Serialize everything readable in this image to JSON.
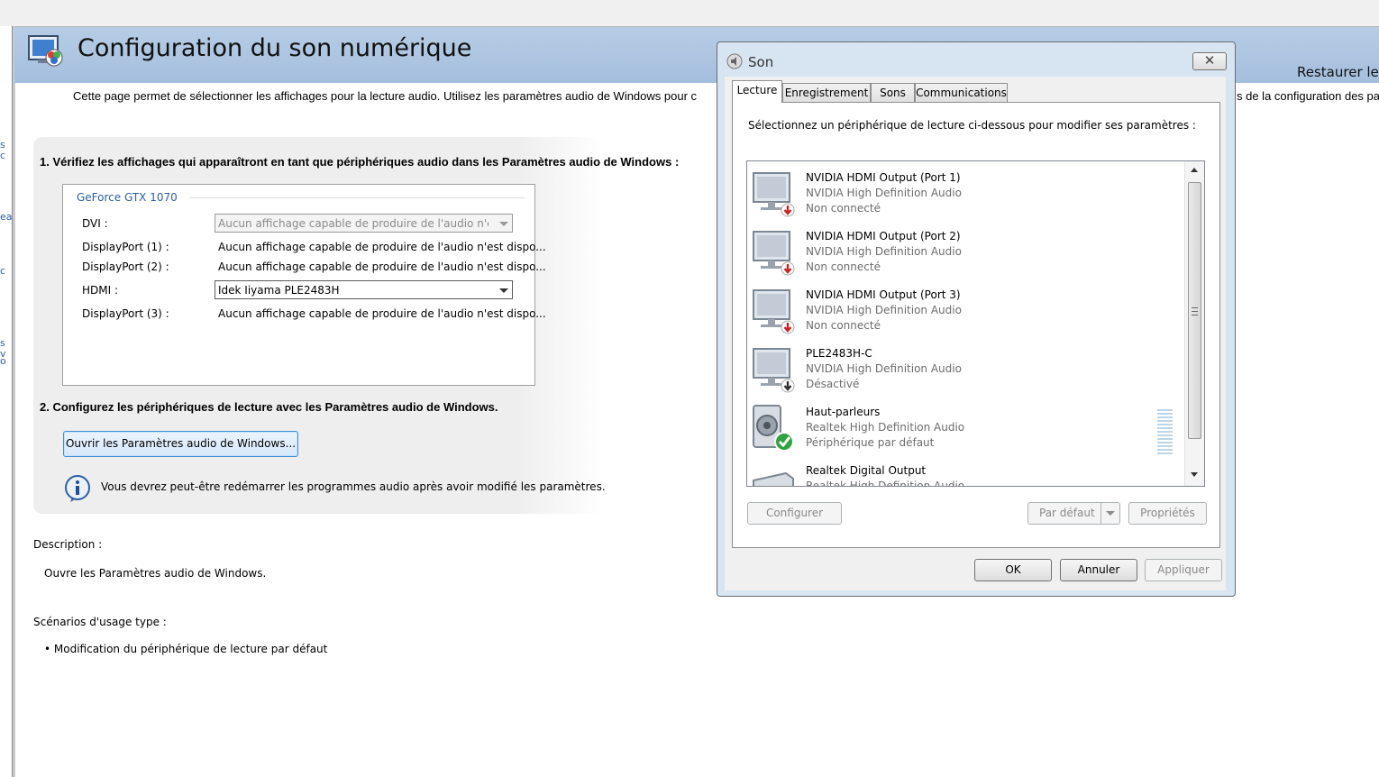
{
  "left_fragments": [
    "s c",
    "ea",
    "c",
    "s v",
    "o"
  ],
  "page": {
    "title": "Configuration du son numérique",
    "restore_link": "Restaurer les",
    "intro": "Cette page permet de sélectionner les affichages pour la lecture audio. Utilisez les paramètres audio de Windows pour c",
    "intro_right": "s de la configuration des pa"
  },
  "step1": {
    "heading": "1. Vérifiez les affichages qui apparaîtront en tant que périphériques audio dans les Paramètres audio de Windows :",
    "gpu_name": "GeForce GTX 1070",
    "ports": [
      {
        "label": "DVI :",
        "value": "Aucun affichage capable de produire de l'audio n'est c",
        "control": "dropdown-disabled"
      },
      {
        "label": "DisplayPort (1) :",
        "value": "Aucun affichage capable de produire de l'audio n'est dispo...",
        "control": "text"
      },
      {
        "label": "DisplayPort (2) :",
        "value": "Aucun affichage capable de produire de l'audio n'est dispo...",
        "control": "text"
      },
      {
        "label": "HDMI :",
        "value": "Idek Iiyama PLE2483H",
        "control": "dropdown"
      },
      {
        "label": "DisplayPort (3) :",
        "value": "Aucun affichage capable de produire de l'audio n'est dispo...",
        "control": "text"
      }
    ]
  },
  "step2": {
    "heading": "2. Configurez les périphériques de lecture avec les Paramètres audio de Windows.",
    "open_button": "Ouvrir les Paramètres audio de Windows...",
    "info_text": "Vous devrez peut-être redémarrer les programmes audio après avoir modifié les paramètres."
  },
  "description": {
    "label": "Description :",
    "text": "Ouvre les Paramètres audio de Windows."
  },
  "scenarios": {
    "label": "Scénarios d'usage type :",
    "items": [
      "• Modification du périphérique de lecture par défaut"
    ]
  },
  "dialog": {
    "title": "Son",
    "close": "✕",
    "tabs": [
      "Lecture",
      "Enregistrement",
      "Sons",
      "Communications"
    ],
    "active_tab": "Lecture",
    "instruction": "Sélectionnez un périphérique de lecture ci-dessous pour modifier ses paramètres :",
    "devices": [
      {
        "name": "NVIDIA HDMI Output (Port 1)",
        "driver": "NVIDIA High Definition Audio",
        "status": "Non connecté",
        "icon": "monitor-icon",
        "badge": "red-down-arrow"
      },
      {
        "name": "NVIDIA HDMI Output (Port 2)",
        "driver": "NVIDIA High Definition Audio",
        "status": "Non connecté",
        "icon": "monitor-icon",
        "badge": "red-down-arrow"
      },
      {
        "name": "NVIDIA HDMI Output (Port 3)",
        "driver": "NVIDIA High Definition Audio",
        "status": "Non connecté",
        "icon": "monitor-icon",
        "badge": "red-down-arrow"
      },
      {
        "name": "PLE2483H-C",
        "driver": "NVIDIA High Definition Audio",
        "status": "Désactivé",
        "icon": "monitor-icon",
        "badge": "gray-down-arrow"
      },
      {
        "name": "Haut-parleurs",
        "driver": "Realtek High Definition Audio",
        "status": "Périphérique par défaut",
        "icon": "speaker-icon",
        "badge": "green-check"
      },
      {
        "name": "Realtek Digital Output",
        "driver": "Realtek High Definition Audio",
        "status": "",
        "icon": "digital-output-icon",
        "badge": ""
      }
    ],
    "buttons": {
      "configure": "Configurer",
      "set_default": "Par défaut",
      "properties": "Propriétés",
      "ok": "OK",
      "cancel": "Annuler",
      "apply": "Appliquer"
    }
  },
  "colors": {
    "header_band": "#a9c2e0",
    "link_blue": "#2e5fa3",
    "dialog_frame": "#d7e4f2",
    "status_gray": "#6d6d6d"
  }
}
